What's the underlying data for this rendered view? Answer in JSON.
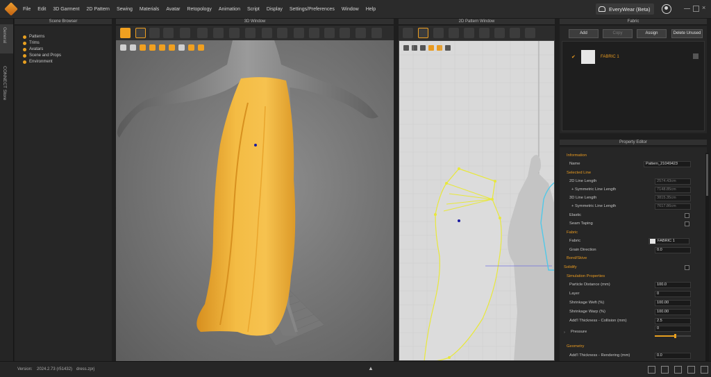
{
  "menu": {
    "items": [
      "File",
      "Edit",
      "3D Garment",
      "2D Pattern",
      "Sewing",
      "Materials",
      "Avatar",
      "Retopology",
      "Animation",
      "Script",
      "Display",
      "Settings/Preferences",
      "Window",
      "Help"
    ],
    "brand": "EveryWear (Beta)"
  },
  "sidebar": {
    "tabs": [
      "General",
      "CONNECT Store"
    ]
  },
  "scene_browser": {
    "title": "Scene Browser",
    "items": [
      "Patterns",
      "Trims",
      "Avatars",
      "Scene and Props",
      "Environment"
    ]
  },
  "window3d": {
    "title": "3D Window"
  },
  "window2d": {
    "title": "2D Pattern Window"
  },
  "fabric": {
    "title": "Fabric",
    "buttons": {
      "add": "Add",
      "copy": "Copy",
      "assign": "Assign",
      "delete": "Delete Unused"
    },
    "items": [
      {
        "name": "FABRIC 1"
      }
    ]
  },
  "property_editor": {
    "title": "Property Editor",
    "information_label": "Information",
    "name_label": "Name",
    "name_value": "Pattern_21049423",
    "selected_line_label": "Selected Line",
    "line_2d_label": "2D Line Length",
    "line_2d_value": "2574.43cm",
    "sym_2d_label": "+ Symmetric Line Length",
    "sym_2d_value": "7148.85cm",
    "line_3d_label": "3D Line Length",
    "line_3d_value": "3815.35cm",
    "sym_3d_label": "+ Symmetric Line Length",
    "sym_3d_value": "7617.86cm",
    "elastic_label": "Elastic",
    "seam_taping_label": "Seam Taping",
    "fabric_section_label": "Fabric",
    "fabric_label": "Fabric",
    "fabric_value": "FABRIC 1",
    "grain_label": "Grain Direction",
    "grain_value": "0.0",
    "bond_label": "Bond/Skive",
    "solidify_label": "Solidify",
    "sim_label": "Simulation Properties",
    "particle_label": "Particle Distance (mm)",
    "particle_value": "100.0",
    "layer_label": "Layer",
    "layer_value": "0",
    "weft_label": "Shrinkage Weft (%)",
    "weft_value": "100.00",
    "warp_label": "Shrinkage Warp (%)",
    "warp_value": "100.00",
    "thick_coll_label": "Add'l Thickness - Collision (mm)",
    "thick_coll_value": "2.5",
    "pressure_label": "Pressure",
    "pressure_value": "0",
    "geometry_label": "Geometry",
    "thick_render_label": "Add'l Thickness - Rendering (mm)",
    "thick_render_value": "0.0"
  },
  "status": {
    "version_label": "Version:",
    "version_value": "2024.2.73 (r51432)",
    "file": "dress.zprj"
  },
  "colors": {
    "accent": "#e89a20",
    "garment": "#f2b43a",
    "pattern_outline": "#e8e83a",
    "pattern_outline_right": "#50c8e8"
  }
}
